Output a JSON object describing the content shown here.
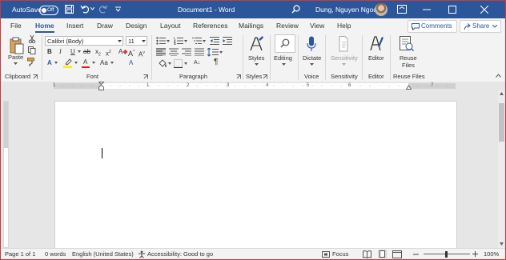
{
  "window": {
    "autosave_label": "AutoSave",
    "autosave_state": "Off",
    "document_title": "Document1  -  Word",
    "user_name": "Dung, Nguyen Ngoc"
  },
  "tabs": [
    "File",
    "Home",
    "Insert",
    "Draw",
    "Design",
    "Layout",
    "References",
    "Mailings",
    "Review",
    "View",
    "Help"
  ],
  "active_tab": "Home",
  "top_buttons": {
    "comments": "Comments",
    "share": "Share"
  },
  "ribbon": {
    "clipboard": {
      "paste_label": "Paste",
      "group_label": "Clipboard"
    },
    "font": {
      "font_name": "Calibri (Body)",
      "font_size": "11",
      "group_label": "Font"
    },
    "paragraph": {
      "group_label": "Paragraph"
    },
    "styles": {
      "button_label": "Styles",
      "group_label": "Styles"
    },
    "editing": {
      "button_label": "Editing"
    },
    "voice": {
      "dictate_label": "Dictate",
      "group_label": "Voice"
    },
    "sensitivity": {
      "button_label": "Sensitivity",
      "group_label": "Sensitivity"
    },
    "editor": {
      "button_label": "Editor",
      "group_label": "Editor"
    },
    "reuse": {
      "button_label_1": "Reuse",
      "button_label_2": "Files",
      "group_label": "Reuse Files"
    }
  },
  "ruler": {
    "numbers": [
      "1",
      "1",
      "2",
      "3",
      "4",
      "5",
      "6",
      "7"
    ]
  },
  "status_bar": {
    "page": "Page 1 of 1",
    "words": "0 words",
    "language": "English (United States)",
    "accessibility": "Accessibility: Good to go",
    "focus": "Focus",
    "zoom": "100%"
  },
  "colors": {
    "accent": "#2b579a",
    "ribbon_bg": "#f3f3f3",
    "canvas_bg": "#e6e6e6"
  },
  "icons": [
    "save-icon",
    "undo-icon",
    "redo-icon",
    "customize-icon",
    "search-icon",
    "ribbon-display-icon",
    "minimize-icon",
    "maximize-icon",
    "close-icon"
  ]
}
